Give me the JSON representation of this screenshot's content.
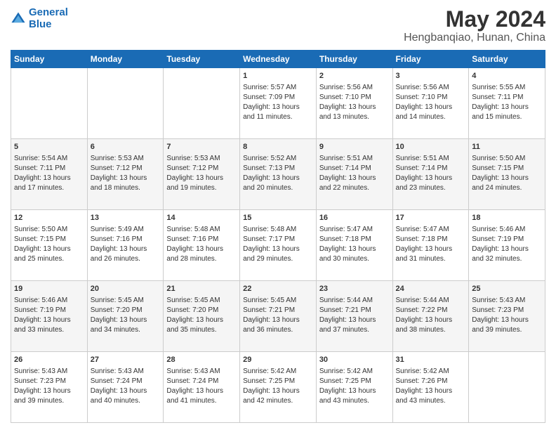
{
  "logo": {
    "line1": "General",
    "line2": "Blue"
  },
  "title": "May 2024",
  "subtitle": "Hengbanqiao, Hunan, China",
  "headers": [
    "Sunday",
    "Monday",
    "Tuesday",
    "Wednesday",
    "Thursday",
    "Friday",
    "Saturday"
  ],
  "weeks": [
    [
      {
        "date": "",
        "info": ""
      },
      {
        "date": "",
        "info": ""
      },
      {
        "date": "",
        "info": ""
      },
      {
        "date": "1",
        "info": "Sunrise: 5:57 AM\nSunset: 7:09 PM\nDaylight: 13 hours and 11 minutes."
      },
      {
        "date": "2",
        "info": "Sunrise: 5:56 AM\nSunset: 7:10 PM\nDaylight: 13 hours and 13 minutes."
      },
      {
        "date": "3",
        "info": "Sunrise: 5:56 AM\nSunset: 7:10 PM\nDaylight: 13 hours and 14 minutes."
      },
      {
        "date": "4",
        "info": "Sunrise: 5:55 AM\nSunset: 7:11 PM\nDaylight: 13 hours and 15 minutes."
      }
    ],
    [
      {
        "date": "5",
        "info": "Sunrise: 5:54 AM\nSunset: 7:11 PM\nDaylight: 13 hours and 17 minutes."
      },
      {
        "date": "6",
        "info": "Sunrise: 5:53 AM\nSunset: 7:12 PM\nDaylight: 13 hours and 18 minutes."
      },
      {
        "date": "7",
        "info": "Sunrise: 5:53 AM\nSunset: 7:12 PM\nDaylight: 13 hours and 19 minutes."
      },
      {
        "date": "8",
        "info": "Sunrise: 5:52 AM\nSunset: 7:13 PM\nDaylight: 13 hours and 20 minutes."
      },
      {
        "date": "9",
        "info": "Sunrise: 5:51 AM\nSunset: 7:14 PM\nDaylight: 13 hours and 22 minutes."
      },
      {
        "date": "10",
        "info": "Sunrise: 5:51 AM\nSunset: 7:14 PM\nDaylight: 13 hours and 23 minutes."
      },
      {
        "date": "11",
        "info": "Sunrise: 5:50 AM\nSunset: 7:15 PM\nDaylight: 13 hours and 24 minutes."
      }
    ],
    [
      {
        "date": "12",
        "info": "Sunrise: 5:50 AM\nSunset: 7:15 PM\nDaylight: 13 hours and 25 minutes."
      },
      {
        "date": "13",
        "info": "Sunrise: 5:49 AM\nSunset: 7:16 PM\nDaylight: 13 hours and 26 minutes."
      },
      {
        "date": "14",
        "info": "Sunrise: 5:48 AM\nSunset: 7:16 PM\nDaylight: 13 hours and 28 minutes."
      },
      {
        "date": "15",
        "info": "Sunrise: 5:48 AM\nSunset: 7:17 PM\nDaylight: 13 hours and 29 minutes."
      },
      {
        "date": "16",
        "info": "Sunrise: 5:47 AM\nSunset: 7:18 PM\nDaylight: 13 hours and 30 minutes."
      },
      {
        "date": "17",
        "info": "Sunrise: 5:47 AM\nSunset: 7:18 PM\nDaylight: 13 hours and 31 minutes."
      },
      {
        "date": "18",
        "info": "Sunrise: 5:46 AM\nSunset: 7:19 PM\nDaylight: 13 hours and 32 minutes."
      }
    ],
    [
      {
        "date": "19",
        "info": "Sunrise: 5:46 AM\nSunset: 7:19 PM\nDaylight: 13 hours and 33 minutes."
      },
      {
        "date": "20",
        "info": "Sunrise: 5:45 AM\nSunset: 7:20 PM\nDaylight: 13 hours and 34 minutes."
      },
      {
        "date": "21",
        "info": "Sunrise: 5:45 AM\nSunset: 7:20 PM\nDaylight: 13 hours and 35 minutes."
      },
      {
        "date": "22",
        "info": "Sunrise: 5:45 AM\nSunset: 7:21 PM\nDaylight: 13 hours and 36 minutes."
      },
      {
        "date": "23",
        "info": "Sunrise: 5:44 AM\nSunset: 7:21 PM\nDaylight: 13 hours and 37 minutes."
      },
      {
        "date": "24",
        "info": "Sunrise: 5:44 AM\nSunset: 7:22 PM\nDaylight: 13 hours and 38 minutes."
      },
      {
        "date": "25",
        "info": "Sunrise: 5:43 AM\nSunset: 7:23 PM\nDaylight: 13 hours and 39 minutes."
      }
    ],
    [
      {
        "date": "26",
        "info": "Sunrise: 5:43 AM\nSunset: 7:23 PM\nDaylight: 13 hours and 39 minutes."
      },
      {
        "date": "27",
        "info": "Sunrise: 5:43 AM\nSunset: 7:24 PM\nDaylight: 13 hours and 40 minutes."
      },
      {
        "date": "28",
        "info": "Sunrise: 5:43 AM\nSunset: 7:24 PM\nDaylight: 13 hours and 41 minutes."
      },
      {
        "date": "29",
        "info": "Sunrise: 5:42 AM\nSunset: 7:25 PM\nDaylight: 13 hours and 42 minutes."
      },
      {
        "date": "30",
        "info": "Sunrise: 5:42 AM\nSunset: 7:25 PM\nDaylight: 13 hours and 43 minutes."
      },
      {
        "date": "31",
        "info": "Sunrise: 5:42 AM\nSunset: 7:26 PM\nDaylight: 13 hours and 43 minutes."
      },
      {
        "date": "",
        "info": ""
      }
    ]
  ]
}
